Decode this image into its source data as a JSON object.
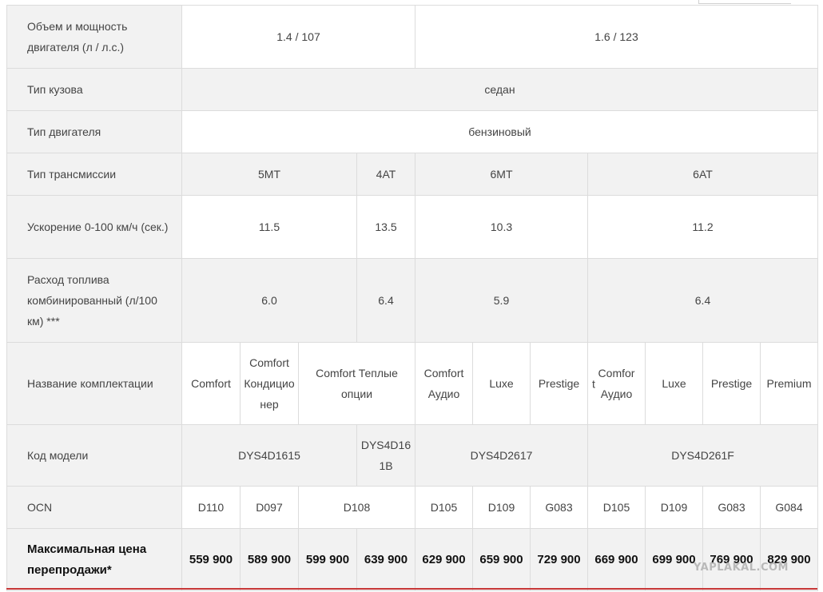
{
  "rows": {
    "engine": {
      "label": "Объем и мощность двигателя (л / л.с.)",
      "v1": "1.4 / 107",
      "v2": "1.6 / 123"
    },
    "body": {
      "label": "Тип кузова",
      "v1": "седан"
    },
    "engine_type": {
      "label": "Тип двигателя",
      "v1": "бензиновый"
    },
    "transmission": {
      "label": "Тип трансмиссии",
      "values": [
        "5MT",
        "4AT",
        "6MT",
        "6AT"
      ]
    },
    "accel": {
      "label": "Ускорение 0-100 км/ч (сек.)",
      "values": [
        "11.5",
        "13.5",
        "10.3",
        "11.2"
      ]
    },
    "fuel": {
      "label": "Расход топлива комбинированный (л/100 км) ***",
      "values": [
        "6.0",
        "6.4",
        "5.9",
        "6.4"
      ]
    },
    "trim": {
      "label": "Название комплектации",
      "values": [
        "Comfort",
        "Comfort Кондиционер",
        "Comfort Теплые опции",
        "Comfort Аудио",
        "Luxe",
        "Prestige",
        "Comfor",
        "Luxe",
        "Prestige",
        "Premium"
      ],
      "split_prefix": "t",
      "split_text": "Аудио"
    },
    "model_code": {
      "label": "Код модели",
      "values": [
        "DYS4D1615",
        "DYS4D161B",
        "DYS4D2617",
        "DYS4D261F"
      ]
    },
    "ocn": {
      "label": "OCN",
      "values": [
        "D110",
        "D097",
        "D108",
        "D105",
        "D109",
        "G083",
        "D105",
        "D109",
        "G083",
        "G084"
      ]
    },
    "price": {
      "label": "Максимальная цена перепродажи*",
      "values": [
        "559 900",
        "589 900",
        "599 900",
        "639 900",
        "629 900",
        "659 900",
        "729 900",
        "669 900",
        "699 900",
        "769 900",
        "829 900"
      ]
    }
  },
  "watermark": "YAPLAKAL.COM",
  "colors": {
    "label_bg": "#f2f2f2",
    "border": "#dcdcdc",
    "accent": "#c83838"
  }
}
